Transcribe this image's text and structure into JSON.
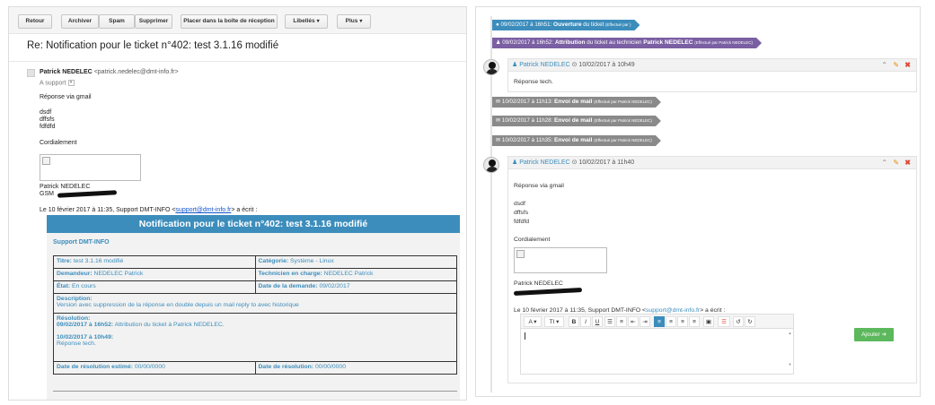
{
  "gmail": {
    "toolbar": {
      "back": "Retour",
      "archive": "Archiver",
      "spam": "Spam",
      "delete": "Supprimer",
      "inbox": "Placer dans la boîte de réception",
      "labels": "Libellés",
      "more": "Plus"
    },
    "subject": "Re: Notification pour le ticket n°402: test 3.1.16 modifié",
    "sender_name": "Patrick NEDELEC",
    "sender_email": "<patrick.nedelec@dmt-info.fr>",
    "to": "A support",
    "body": [
      "Réponse via gmail",
      "dsdf",
      "dffsfs",
      "fdfdfd",
      "Cordialement"
    ],
    "signature_name": "Patrick NEDELEC",
    "signature_gsm": "GSM",
    "wrote_prefix": "Le 10 février 2017 à 11:35, Support DMT-INFO <",
    "wrote_link": "support@dmt-info.fr",
    "wrote_suffix": "> a écrit :",
    "notification": {
      "title": "Notification pour le ticket n°402: test 3.1.16 modifié",
      "company": "Support DMT-INFO",
      "title_label": "Titre:",
      "title_value": "test 3.1.16 modifié",
      "category_label": "Catégorie:",
      "category_value": "Système - Linux",
      "requester_label": "Demandeur:",
      "requester_value": "NEDELEC Patrick",
      "tech_label": "Technicien en charge:",
      "tech_value": "NEDELEC Patrick",
      "state_label": "État:",
      "state_value": "En cours",
      "date_label": "Date de la demande:",
      "date_value": "09/02/2017",
      "description_label": "Description:",
      "description_value": "Version avec suppression de la réponse en double depuis un mail reply to avec historique",
      "resolution_label": "Résolution:",
      "res1_date": "09/02/2017 à 16h52:",
      "res1_text": "Attribution du ticket à Patrick NEDELEC.",
      "res2_date": "10/02/2017 à 10h49:",
      "res2_text": "Réponse tech.",
      "est_label": "Date de résolution estimé:",
      "est_value": "00/00/0000",
      "resdate_label": "Date de résolution:",
      "resdate_value": "00/00/0000"
    }
  },
  "ticket": {
    "events": {
      "opening": {
        "date": "09/02/2017 à 16h51:",
        "action": "Ouverture",
        "rest": "du ticket",
        "by": "(Effectué par )"
      },
      "assign": {
        "date": "09/02/2017 à 16h52:",
        "action": "Attribution",
        "rest": "du ticket au technicien",
        "tech": "Patrick NEDELEC",
        "by": "(Effectué par Patrick NEDELEC)"
      },
      "mail1": {
        "date": "10/02/2017 à 11h13:",
        "action": "Envoi de mail",
        "by": "(Effectué par Patrick NEDELEC)"
      },
      "mail2": {
        "date": "10/02/2017 à 11h28:",
        "action": "Envoi de mail",
        "by": "(Effectué par Patrick NEDELEC)"
      },
      "mail3": {
        "date": "10/02/2017 à 11h35:",
        "action": "Envoi de mail",
        "by": "(Effectué par Patrick NEDELEC)"
      }
    },
    "reply1": {
      "author": "Patrick NEDELEC",
      "date": "10/02/2017 à 10h49",
      "text": "Réponse tech."
    },
    "reply2": {
      "author": "Patrick NEDELEC",
      "date": "10/02/2017 à 11h40",
      "body": [
        "Réponse via gmail",
        "dsdf",
        "dffsfs",
        "fdfdfd",
        "Cordialement"
      ],
      "signature": "Patrick NEDELEC",
      "wrote_prefix": "Le 10 février 2017 à 11:35, Support DMT-INFO <",
      "wrote_link": "support@dmt-info.fr",
      "wrote_suffix": "> a écrit :"
    },
    "editor": {
      "font_btn": "A",
      "size_btn": "TI"
    },
    "add_button": "Ajouter ➔",
    "colors": {
      "blue": "#3c8dbc",
      "purple": "#7b5fa3",
      "gray": "#8a8a8a",
      "green": "#5cb85c"
    },
    "icons": [
      "calendar-icon",
      "user-icon",
      "envelope-icon",
      "clock-icon",
      "chevron-up-icon",
      "pencil-icon",
      "close-icon"
    ]
  }
}
